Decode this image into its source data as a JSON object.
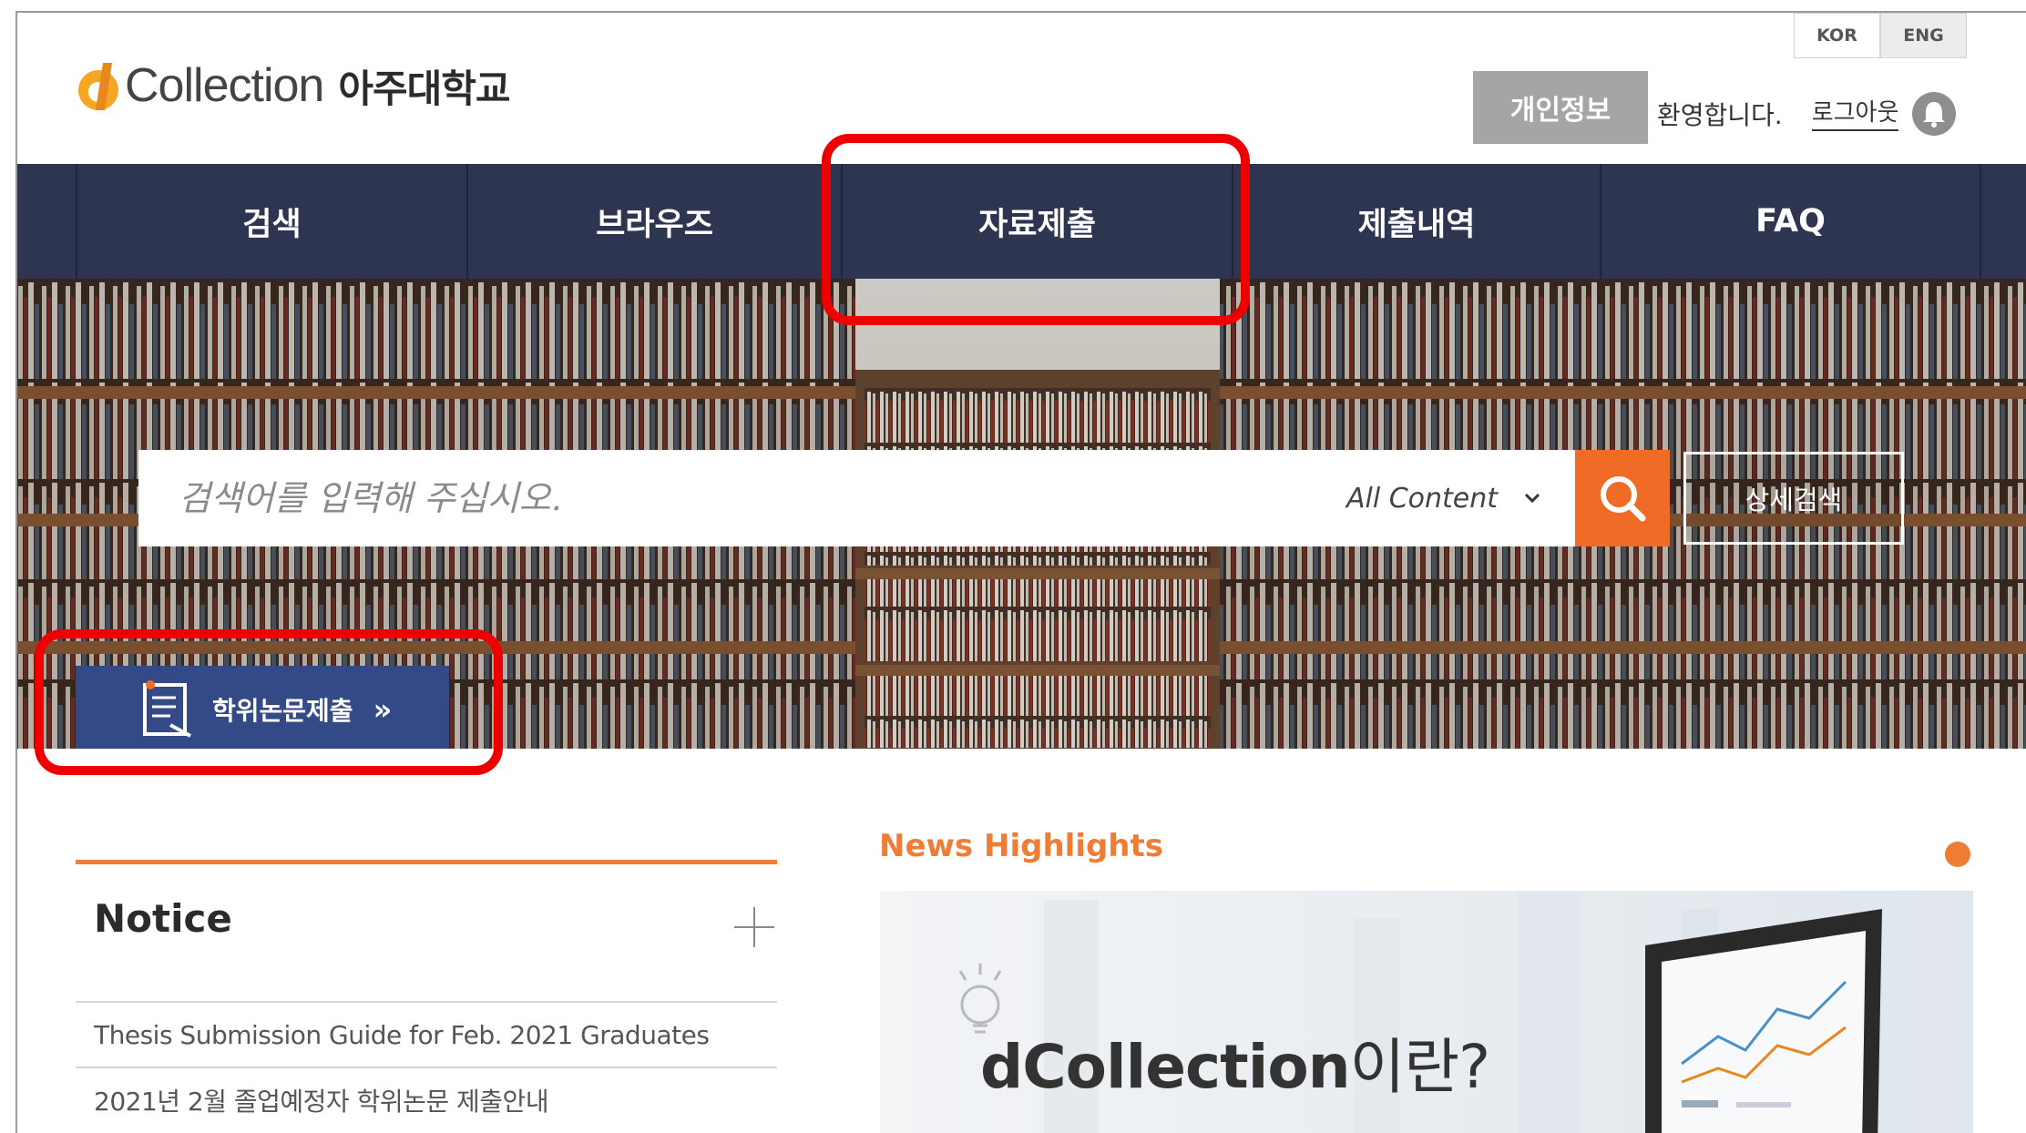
{
  "header": {
    "lang_kor": "KOR",
    "lang_eng": "ENG",
    "logo_word": "Collection",
    "logo_school": "아주대학교",
    "privacy_button": "개인정보",
    "welcome_text": "환영합니다.",
    "logout_link": "로그아웃"
  },
  "nav": {
    "items": [
      {
        "label": "검색"
      },
      {
        "label": "브라우즈"
      },
      {
        "label": "자료제출"
      },
      {
        "label": "제출내역"
      },
      {
        "label": "FAQ"
      }
    ]
  },
  "search": {
    "placeholder": "검색어를 입력해 주십시오.",
    "scope_selected": "All Content",
    "advanced_button": "상세검색"
  },
  "thesis_button": {
    "label": "학위논문제출",
    "arrow": "»"
  },
  "notice": {
    "title": "Notice",
    "items": [
      {
        "text": "Thesis Submission Guide for Feb. 2021 Graduates"
      },
      {
        "text": "2021년 2월 졸업예정자 학위논문 제출안내"
      }
    ]
  },
  "news": {
    "title": "News Highlights",
    "banner_brand": "dCollection",
    "banner_suffix": "이란?"
  },
  "colors": {
    "nav_bg": "#2e3550",
    "accent_orange": "#f06c26",
    "thesis_button_bg": "#334a86",
    "highlight_red": "#ee0000"
  }
}
